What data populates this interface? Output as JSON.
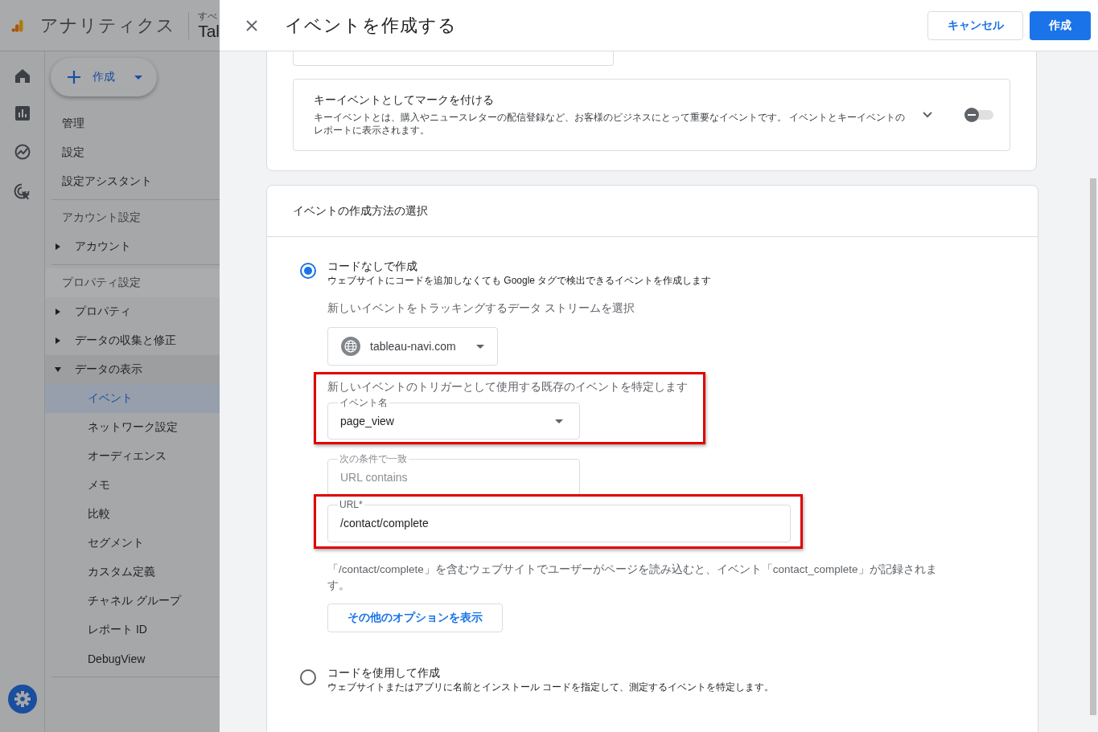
{
  "app_header": {
    "product": "アナリティクス",
    "account_label": "すべ",
    "property_name": "Tal"
  },
  "create_button": {
    "label": "作成"
  },
  "nav": {
    "top_items": [
      "管理",
      "設定",
      "設定アシスタント"
    ],
    "sections": [
      {
        "title": "アカウント設定",
        "items": [
          {
            "label": "アカウント",
            "expanded": false
          }
        ]
      },
      {
        "title": "プロパティ設定",
        "items": [
          {
            "label": "プロパティ",
            "expanded": false
          },
          {
            "label": "データの収集と修正",
            "expanded": false
          },
          {
            "label": "データの表示",
            "expanded": true,
            "children": [
              {
                "label": "イベント",
                "selected": true
              },
              {
                "label": "ネットワーク設定",
                "selected": false
              },
              {
                "label": "オーディエンス",
                "selected": false
              },
              {
                "label": "メモ",
                "selected": false
              },
              {
                "label": "比較",
                "selected": false
              },
              {
                "label": "セグメント",
                "selected": false
              },
              {
                "label": "カスタム定義",
                "selected": false
              },
              {
                "label": "チャネル グループ",
                "selected": false
              },
              {
                "label": "レポート ID",
                "selected": false
              },
              {
                "label": "DebugView",
                "selected": false
              }
            ]
          }
        ]
      }
    ]
  },
  "panel": {
    "title": "イベントを作成する",
    "cancel": "キャンセル",
    "submit": "作成"
  },
  "key_event": {
    "title": "キーイベントとしてマークを付ける",
    "description": "キーイベントとは、購入やニュースレターの配信登録など、お客様のビジネスにとって重要なイベントです。 イベントとキーイベントのレポートに表示されます。",
    "expanded": false,
    "on": false
  },
  "method": {
    "heading": "イベントの作成方法の選択",
    "options": [
      {
        "kind": "no_code",
        "label": "コードなしで作成",
        "description": "ウェブサイトにコードを追加しなくても Google タグで検出できるイベントを作成します",
        "selected": true,
        "stream_prompt": "新しいイベントをトラッキングするデータ ストリームを選択",
        "stream": "tableau-navi.com",
        "trigger": {
          "highlighted": true,
          "prompt": "新しいイベントのトリガーとして使用する既存のイベントを特定します",
          "field_label": "イベント名",
          "value": "page_view"
        },
        "match": {
          "label": "次の条件で一致",
          "value": "URL contains",
          "disabled": true
        },
        "url": {
          "highlighted": true,
          "label": "URL*",
          "value": "/contact/complete"
        },
        "help": "「/contact/complete」を含むウェブサイトでユーザーがページを読み込むと、イベント「contact_complete」が記録されます。",
        "more_button": "その他のオプションを表示"
      },
      {
        "kind": "code",
        "label": "コードを使用して作成",
        "description": "ウェブサイトまたはアプリに名前とインストール コードを指定して、測定するイベントを特定します。",
        "selected": false
      }
    ]
  }
}
